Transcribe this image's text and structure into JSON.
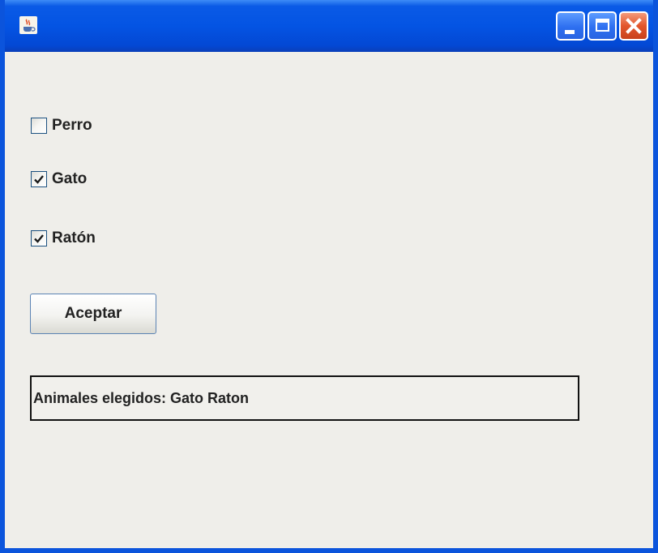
{
  "window": {
    "title": "",
    "app_icon": "java-cup-icon",
    "controls": {
      "minimize_icon": "minimize-icon",
      "maximize_icon": "maximize-icon",
      "close_icon": "close-icon"
    }
  },
  "checkboxes": [
    {
      "label": "Perro",
      "checked": false
    },
    {
      "label": "Gato",
      "checked": true
    },
    {
      "label": "Ratón",
      "checked": true
    }
  ],
  "accept_button": {
    "label": "Aceptar"
  },
  "result": {
    "text": "Animales elegidos: Gato Raton"
  },
  "colors": {
    "titlebar": "#0454e3",
    "content_bg": "#efeeea",
    "close_button": "#e2562b",
    "check_mark": "#2a9a2a"
  }
}
